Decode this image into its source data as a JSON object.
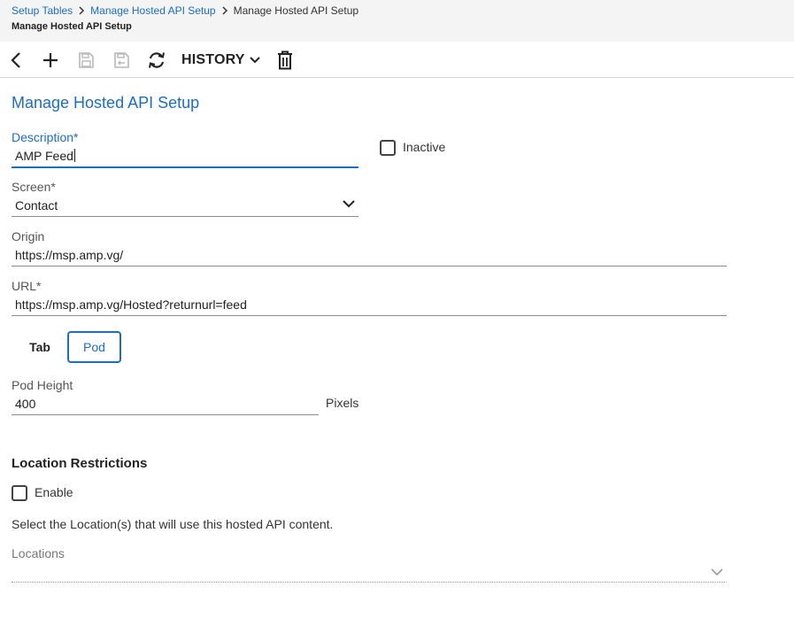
{
  "breadcrumb": {
    "items": [
      "Setup Tables",
      "Manage Hosted API Setup"
    ],
    "current": "Manage Hosted API Setup"
  },
  "header": {
    "subtitle": "Manage Hosted API Setup"
  },
  "toolbar": {
    "icons": [
      "back-icon",
      "add-icon",
      "save-icon",
      "save-and-close-icon",
      "refresh-icon",
      "chevron-down-icon",
      "delete-icon"
    ],
    "history_label": "HISTORY"
  },
  "form": {
    "title": "Manage Hosted API Setup",
    "description": {
      "label": "Description*",
      "value": "AMP Feed"
    },
    "inactive": {
      "label": "Inactive",
      "checked": false
    },
    "screen": {
      "label": "Screen*",
      "value": "Contact"
    },
    "origin": {
      "label": "Origin",
      "value": "https://msp.amp.vg/"
    },
    "url": {
      "label": "URL*",
      "value": "https://msp.amp.vg/Hosted?returnurl=feed"
    },
    "tabs": [
      {
        "label": "Tab",
        "selected": false
      },
      {
        "label": "Pod",
        "selected": true
      }
    ],
    "pod_height": {
      "label": "Pod Height",
      "value": "400",
      "unit": "Pixels"
    }
  },
  "location_restrictions": {
    "title": "Location Restrictions",
    "enable": {
      "label": "Enable",
      "checked": false
    },
    "help_text": "Select the Location(s) that will use this hosted API content.",
    "locations": {
      "label": "Locations",
      "value": ""
    }
  },
  "colors": {
    "accent": "#1b6ec2",
    "topbar_bg": "#f4f4f4",
    "text": "#212121"
  }
}
